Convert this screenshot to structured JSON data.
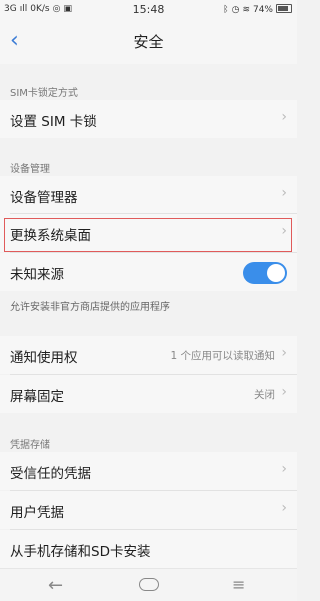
{
  "statusbar": {
    "network": "3G",
    "signal": "ıll",
    "speed": "0K/s",
    "time": "15:48",
    "battery": "74%",
    "battery_level": 0.74
  },
  "header": {
    "back_glyph": "‹",
    "title": "安全"
  },
  "sections": {
    "sim": {
      "label": "SIM卡锁定方式",
      "item": "设置 SIM 卡锁"
    },
    "device": {
      "label": "设备管理",
      "items": [
        "设备管理器",
        "更换系统桌面",
        "未知来源"
      ],
      "unknown_sources_on": true,
      "note": "允许安装非官方商店提供的应用程序"
    },
    "misc": {
      "items": [
        {
          "label": "通知使用权",
          "value": "1 个应用可以读取通知"
        },
        {
          "label": "屏幕固定",
          "value": "关闭"
        }
      ]
    },
    "credentials": {
      "label": "凭据存储",
      "items": [
        "受信任的凭据",
        "用户凭据",
        "从手机存储和SD卡安装"
      ]
    }
  },
  "icons": {
    "chevron": "›",
    "nav_back": "←",
    "nav_menu": "≡"
  }
}
